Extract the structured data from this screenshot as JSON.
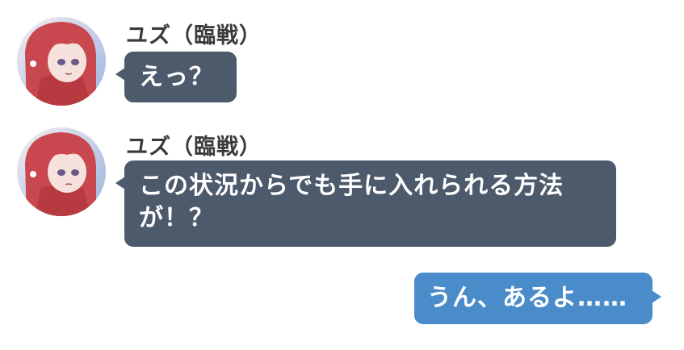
{
  "messages": [
    {
      "sender": "ユズ（臨戦）",
      "lines": [
        "えっ？"
      ],
      "avatar_icon": "character-avatar-icon"
    },
    {
      "sender": "ユズ（臨戦）",
      "lines": [
        "この状況からでも手に入れられる方法",
        "が！？"
      ],
      "avatar_icon": "character-avatar-icon"
    },
    {
      "sender": "",
      "lines": [
        "うん、あるよ……"
      ]
    }
  ],
  "colors": {
    "incoming_bubble": "#4c5a6c",
    "outgoing_bubble": "#4a8bca",
    "sender_name": "#3a3a3a"
  }
}
